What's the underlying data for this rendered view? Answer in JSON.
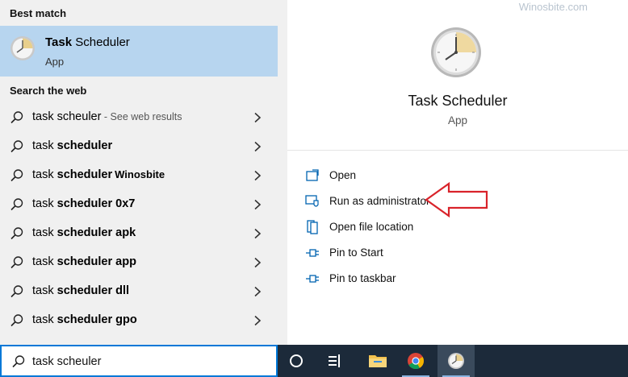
{
  "left": {
    "best_match_title": "Best match",
    "best_match": {
      "name_bold": "Task",
      "name_rest": " Scheduler",
      "type": "App",
      "icon": "clock-icon"
    },
    "web_title": "Search the web",
    "web_results": [
      {
        "prefix": "task scheuler",
        "bold": "",
        "sub": " - See web results",
        "brand": ""
      },
      {
        "prefix": "task ",
        "bold": "scheduler",
        "sub": "",
        "brand": ""
      },
      {
        "prefix": "task ",
        "bold": "scheduler",
        "sub": "",
        "brand": "Winosbite"
      },
      {
        "prefix": "task ",
        "bold": "scheduler 0x7",
        "sub": "",
        "brand": ""
      },
      {
        "prefix": "task ",
        "bold": "scheduler apk",
        "sub": "",
        "brand": ""
      },
      {
        "prefix": "task ",
        "bold": "scheduler app",
        "sub": "",
        "brand": ""
      },
      {
        "prefix": "task ",
        "bold": "scheduler dll",
        "sub": "",
        "brand": ""
      },
      {
        "prefix": "task ",
        "bold": "scheduler gpo",
        "sub": "",
        "brand": ""
      }
    ]
  },
  "right": {
    "watermark": "Winosbite.com",
    "title": "Task Scheduler",
    "subtitle": "App",
    "actions": [
      {
        "label": "Open",
        "icon": "open-window-icon"
      },
      {
        "label": "Run as administrator",
        "icon": "shield-window-icon"
      },
      {
        "label": "Open file location",
        "icon": "file-location-icon"
      },
      {
        "label": "Pin to Start",
        "icon": "pin-icon"
      },
      {
        "label": "Pin to taskbar",
        "icon": "pin-icon"
      }
    ]
  },
  "search": {
    "value": "task scheuler"
  },
  "taskbar": {
    "items": [
      "cortana-icon",
      "task-view-icon",
      "file-explorer-icon",
      "chrome-icon",
      "task-scheduler-icon"
    ]
  },
  "colors": {
    "selected_bg": "#b7d5ef",
    "accent": "#0078d7",
    "taskbar_bg": "#1c2a3a",
    "annotation_arrow": "#d9232a"
  }
}
